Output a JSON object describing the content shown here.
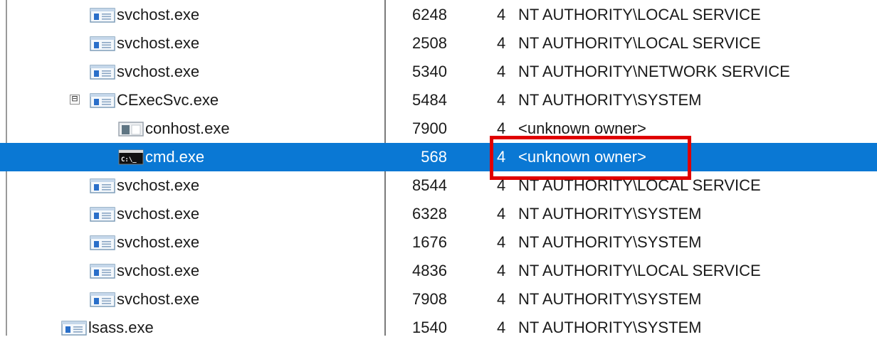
{
  "processes": [
    {
      "name": "svchost.exe",
      "pid": "6248",
      "priority": "4",
      "owner": "NT AUTHORITY\\LOCAL SERVICE",
      "icon": "service-window-icon",
      "indent": 1
    },
    {
      "name": "svchost.exe",
      "pid": "2508",
      "priority": "4",
      "owner": "NT AUTHORITY\\LOCAL SERVICE",
      "icon": "service-window-icon",
      "indent": 1
    },
    {
      "name": "svchost.exe",
      "pid": "5340",
      "priority": "4",
      "owner": "NT AUTHORITY\\NETWORK SERVICE",
      "icon": "service-window-icon",
      "indent": 1
    },
    {
      "name": "CExecSvc.exe",
      "pid": "5484",
      "priority": "4",
      "owner": "NT AUTHORITY\\SYSTEM",
      "icon": "service-window-icon",
      "indent": 1,
      "expander": "⊟"
    },
    {
      "name": "conhost.exe",
      "pid": "7900",
      "priority": "4",
      "owner": "<unknown owner>",
      "icon": "console-host-icon",
      "indent": 2
    },
    {
      "name": "cmd.exe",
      "pid": "568",
      "priority": "4",
      "owner": "<unknown owner>",
      "icon": "command-prompt-icon",
      "indent": 2,
      "selected": true
    },
    {
      "name": "svchost.exe",
      "pid": "8544",
      "priority": "4",
      "owner": "NT AUTHORITY\\LOCAL SERVICE",
      "icon": "service-window-icon",
      "indent": 1
    },
    {
      "name": "svchost.exe",
      "pid": "6328",
      "priority": "4",
      "owner": "NT AUTHORITY\\SYSTEM",
      "icon": "service-window-icon",
      "indent": 1
    },
    {
      "name": "svchost.exe",
      "pid": "1676",
      "priority": "4",
      "owner": "NT AUTHORITY\\SYSTEM",
      "icon": "service-window-icon",
      "indent": 1
    },
    {
      "name": "svchost.exe",
      "pid": "4836",
      "priority": "4",
      "owner": "NT AUTHORITY\\LOCAL SERVICE",
      "icon": "service-window-icon",
      "indent": 1
    },
    {
      "name": "svchost.exe",
      "pid": "7908",
      "priority": "4",
      "owner": "NT AUTHORITY\\SYSTEM",
      "icon": "service-window-icon",
      "indent": 1
    },
    {
      "name": "lsass.exe",
      "pid": "1540",
      "priority": "4",
      "owner": "NT AUTHORITY\\SYSTEM",
      "icon": "service-window-icon",
      "indent": 0
    }
  ],
  "colors": {
    "selection": "#0a78d4",
    "highlight_box": "#e00000"
  }
}
